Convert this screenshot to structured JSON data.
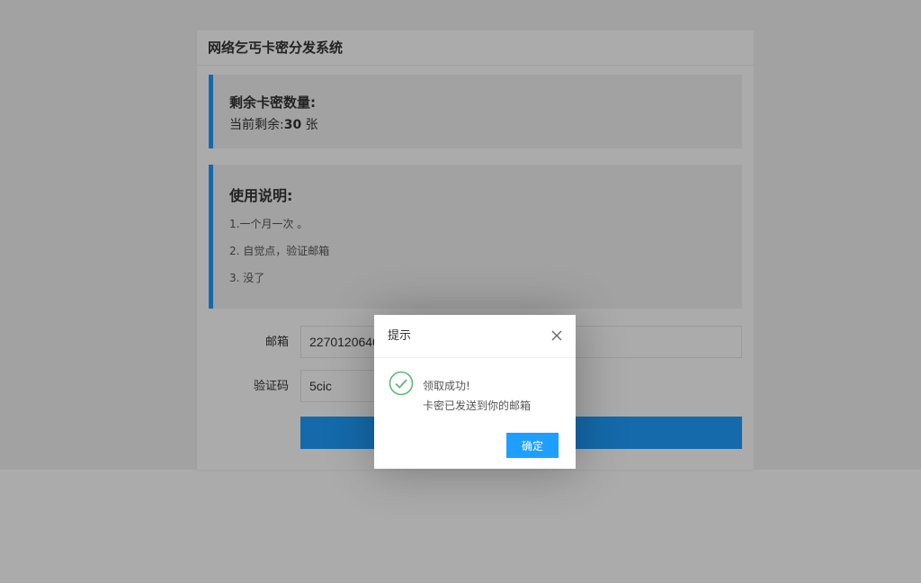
{
  "header": {
    "title": "网络乞丐卡密分发系统"
  },
  "stock": {
    "title": "剩余卡密数量:",
    "prefix": "当前剩余:",
    "count": "30",
    "unit": "张"
  },
  "guide": {
    "title": "使用说明:",
    "items": [
      "1.一个月一次 。",
      "2. 自觉点，验证邮箱",
      "3. 没了"
    ]
  },
  "form": {
    "email_label": "邮箱",
    "email_value": "22701206400",
    "captcha_label": "验证码",
    "captcha_value": "5cic"
  },
  "dialog": {
    "title": "提示",
    "message_line1": "领取成功!",
    "message_line2": "卡密已发送到你的邮箱",
    "confirm_label": "确定"
  },
  "colors": {
    "accent": "#1e9fff",
    "success": "#5fb878"
  },
  "icons": {
    "close": "close-icon",
    "success": "check-circle-icon"
  }
}
